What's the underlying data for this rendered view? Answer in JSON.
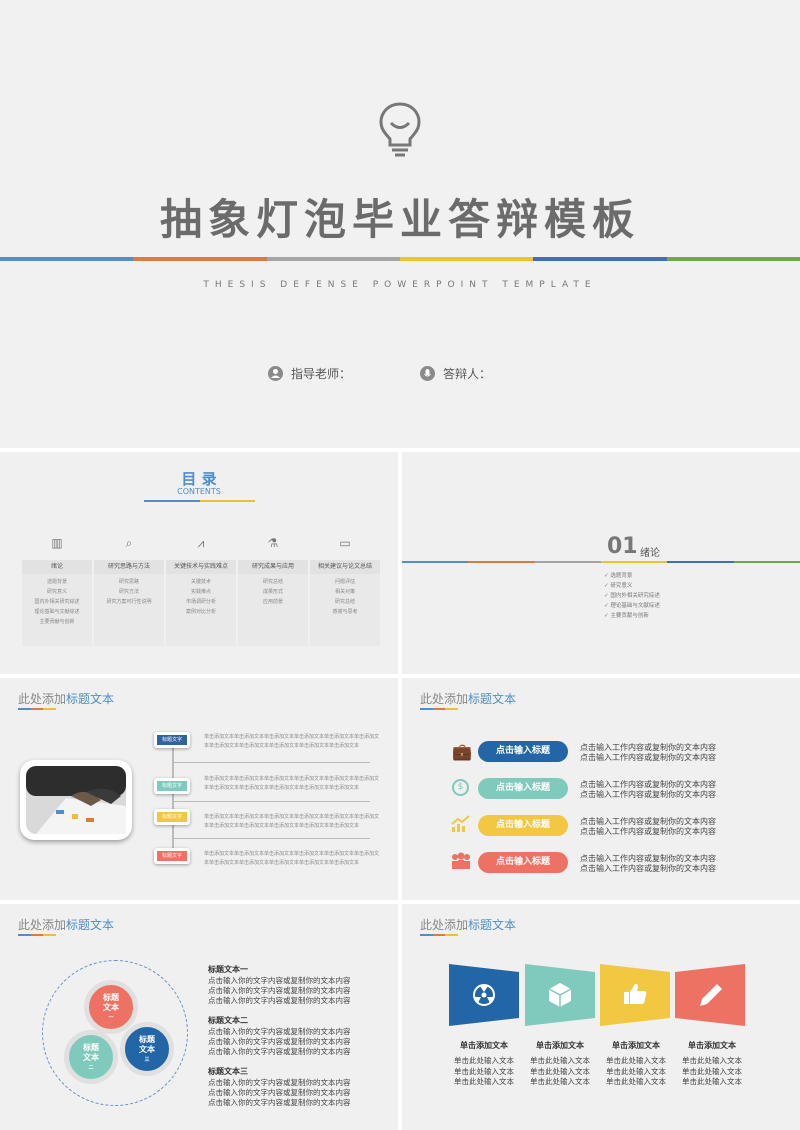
{
  "cover": {
    "title": "抽象灯泡毕业答辩模板",
    "subtitle": "THESIS DEFENSE POWERPOINT TEMPLATE",
    "advisor_label": "指导老师：",
    "defender_label": "答辩人：",
    "stripe_colors": [
      "#4f8fc9",
      "#e07a3a",
      "#a5a5a5",
      "#f1bf2f",
      "#3e6fbf",
      "#6aab45"
    ]
  },
  "toc": {
    "title": "目 录",
    "subtitle": "CONTENTS",
    "columns": [
      {
        "icon": "book-icon",
        "label": "绪论",
        "items": [
          "选题背景",
          "研究意义",
          "国内外相关研究综述",
          "理论基础与文献综述",
          "主要贡献与创新"
        ]
      },
      {
        "icon": "magnifier-icon",
        "label": "研究思路与方法",
        "items": [
          "研究思路",
          "研究方法",
          "研究方案可行性说明"
        ]
      },
      {
        "icon": "compass-icon",
        "label": "关键技术与实践难点",
        "items": [
          "关键技术",
          "实践难点",
          "市场调研分析",
          "案例对比分析"
        ]
      },
      {
        "icon": "microscope-icon",
        "label": "研究成果与应用",
        "items": [
          "研究总结",
          "成果形式",
          "应用前景"
        ]
      },
      {
        "icon": "monitor-icon",
        "label": "相关建议与论文总结",
        "items": [
          "问题评估",
          "相关对策",
          "研究总结",
          "感谢与思考"
        ]
      }
    ]
  },
  "chapter": {
    "number": "01",
    "title": "绪论",
    "items": [
      "选题背景",
      "研究意义",
      "国内外相关研究综述",
      "理论基础与文献综述",
      "主要贡献与创新"
    ]
  },
  "header": {
    "prefix": "此处添加",
    "highlight": "标题文本"
  },
  "timeline": {
    "tags": [
      {
        "label": "标题文字",
        "color": "#2e63a0"
      },
      {
        "label": "标题文字",
        "color": "#7fcabd"
      },
      {
        "label": "标题文字",
        "color": "#f2c742"
      },
      {
        "label": "标题文字",
        "color": "#ee7263"
      }
    ],
    "text_line1": "单击添加文本单击添加文本单击添加文本单击添加文本单击添加文本单击添加文",
    "text_line2": "本单击添加文本单击添加文本单击添加文本单击添加文本单击添加文本"
  },
  "list": {
    "rows": [
      {
        "icon": "briefcase-icon",
        "color": "#2266a8",
        "pill": "点击输入标题",
        "line1": "点击输入工作内容或复制你的文本内容",
        "line2": "点击输入工作内容或复制你的文本内容"
      },
      {
        "icon": "coin-icon",
        "color": "#7fcabd",
        "pill": "点击输入标题",
        "line1": "点击输入工作内容或复制你的文本内容",
        "line2": "点击输入工作内容或复制你的文本内容"
      },
      {
        "icon": "growth-chart-icon",
        "color": "#f2c742",
        "pill": "点击输入标题",
        "line1": "点击输入工作内容或复制你的文本内容",
        "line2": "点击输入工作内容或复制你的文本内容"
      },
      {
        "icon": "team-icon",
        "color": "#ee7263",
        "pill": "点击输入标题",
        "line1": "点击输入工作内容或复制你的文本内容",
        "line2": "点击输入工作内容或复制你的文本内容"
      }
    ]
  },
  "circles": {
    "nodes": [
      {
        "line1": "标题",
        "line2": "文本",
        "line3": "一",
        "color": "#ee7263"
      },
      {
        "line1": "标题",
        "line2": "文本",
        "line3": "二",
        "color": "#7fcabd"
      },
      {
        "line1": "标题",
        "line2": "文本",
        "line3": "三",
        "color": "#2266a8"
      }
    ],
    "blocks": [
      {
        "title": "标题文本一",
        "lines": [
          "点击输入你的文字内容或复制你的文本内容",
          "点击输入你的文字内容或复制你的文本内容",
          "点击输入你的文字内容或复制你的文本内容"
        ]
      },
      {
        "title": "标题文本二",
        "lines": [
          "点击输入你的文字内容或复制你的文本内容",
          "点击输入你的文字内容或复制你的文本内容",
          "点击输入你的文字内容或复制你的文本内容"
        ]
      },
      {
        "title": "标题文本三",
        "lines": [
          "点击输入你的文字内容或复制你的文本内容",
          "点击输入你的文字内容或复制你的文本内容",
          "点击输入你的文字内容或复制你的文本内容"
        ]
      }
    ]
  },
  "columns4": {
    "items": [
      {
        "icon": "radiation-icon",
        "color": "#2266a8",
        "title": "单击添加文本",
        "lines": [
          "单击此处输入文本",
          "单击此处输入文本",
          "单击此处输入文本"
        ]
      },
      {
        "icon": "cube-icon",
        "color": "#7fcabd",
        "title": "单击添加文本",
        "lines": [
          "单击此处输入文本",
          "单击此处输入文本",
          "单击此处输入文本"
        ]
      },
      {
        "icon": "thumbs-up-icon",
        "color": "#f2c742",
        "title": "单击添加文本",
        "lines": [
          "单击此处输入文本",
          "单击此处输入文本",
          "单击此处输入文本"
        ]
      },
      {
        "icon": "pencil-icon",
        "color": "#ee7263",
        "title": "单击添加文本",
        "lines": [
          "单击此处输入文本",
          "单击此处输入文本",
          "单击此处输入文本"
        ]
      }
    ]
  }
}
